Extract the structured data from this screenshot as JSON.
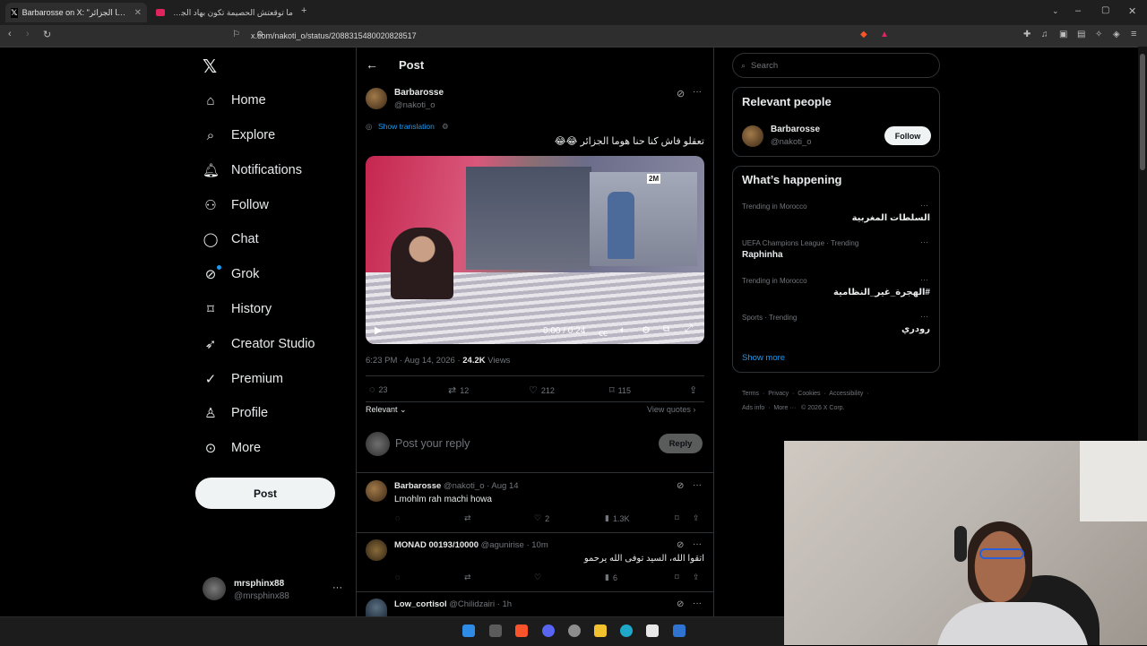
{
  "browser": {
    "tabs": [
      {
        "title": "Barbarosse on X: \"تعقلو فاش كنا حنا هوما الجزائر\"",
        "active": true
      },
      {
        "title": "ما توقعتش الحصيمة تكون بهاد الجمال |",
        "active": false
      }
    ],
    "url": "x.com/nakoti_o/status/2088315480020828517"
  },
  "nav": {
    "items": [
      {
        "label": "Home",
        "icon": "home-icon"
      },
      {
        "label": "Explore",
        "icon": "search-icon"
      },
      {
        "label": "Notifications",
        "icon": "bell-icon"
      },
      {
        "label": "Follow",
        "icon": "add-person-icon"
      },
      {
        "label": "Chat",
        "icon": "chat-icon"
      },
      {
        "label": "Grok",
        "icon": "grok-icon"
      },
      {
        "label": "History",
        "icon": "bookmark-icon"
      },
      {
        "label": "Creator Studio",
        "icon": "rocket-icon"
      },
      {
        "label": "Premium",
        "icon": "verified-icon"
      },
      {
        "label": "Profile",
        "icon": "person-icon"
      },
      {
        "label": "More",
        "icon": "more-circle-icon"
      }
    ],
    "post_label": "Post",
    "account": {
      "name": "mrsphinx88",
      "handle": "@mrsphinx88"
    }
  },
  "post": {
    "header_title": "Post",
    "author": {
      "name": "Barbarosse",
      "handle": "@nakoti_o"
    },
    "show_translation": "Show translation",
    "text": "تعقلو فاش كنا حنا هوما الجزائر 😂😂",
    "video": {
      "time": "0:00 / 0:24",
      "channel_logo": "2M"
    },
    "meta": {
      "time": "6:23 PM · Aug 14, 2026 · ",
      "views_count": "24.2K",
      "views_label": "Views"
    },
    "actions": {
      "replies": "23",
      "reposts": "12",
      "likes": "212",
      "bookmarks": "115"
    },
    "relevant_label": "Relevant",
    "view_quotes": "View quotes",
    "reply_placeholder": "Post your reply",
    "reply_button": "Reply"
  },
  "replies": [
    {
      "name": "Barbarosse",
      "handle": "@nakoti_o · Aug 14",
      "text": "Lmohlm rah machi howa",
      "likes": "2",
      "views": "1.3K",
      "text_align": "left"
    },
    {
      "name": "MONAD 00193/10000",
      "handle": "@agunirise · 10m",
      "text": "اتقوا الله، السيد توفى الله يرحمو",
      "likes": "",
      "views": "6",
      "text_align": "right"
    },
    {
      "name": "Low_cortisol",
      "handle": "@Chilidzairi · 1h",
      "text": "",
      "likes": "",
      "views": "",
      "text_align": "left"
    }
  ],
  "right": {
    "search_placeholder": "Search",
    "relevant_title": "Relevant people",
    "person": {
      "name": "Barbarosse",
      "handle": "@nakoti_o",
      "follow": "Follow"
    },
    "happening_title": "What’s happening",
    "trends": [
      {
        "context": "Trending in Morocco",
        "topic": "السلطات المغربية",
        "align": "right"
      },
      {
        "context": "UEFA Champions League · Trending",
        "topic": "Raphinha",
        "align": "left"
      },
      {
        "context": "Trending in Morocco",
        "topic": "#الهجرة_غير_النظامية",
        "align": "right"
      },
      {
        "context": "Sports · Trending",
        "topic": "رودري",
        "align": "right"
      }
    ],
    "show_more": "Show more",
    "footer": [
      "Terms",
      "Privacy",
      "Cookies",
      "Accessibility",
      "Ads info",
      "More",
      "© 2026 X Corp."
    ]
  },
  "colors": {
    "accent": "#1d9bf0",
    "bg": "#000000",
    "border": "#2f3336",
    "muted": "#71767b"
  }
}
